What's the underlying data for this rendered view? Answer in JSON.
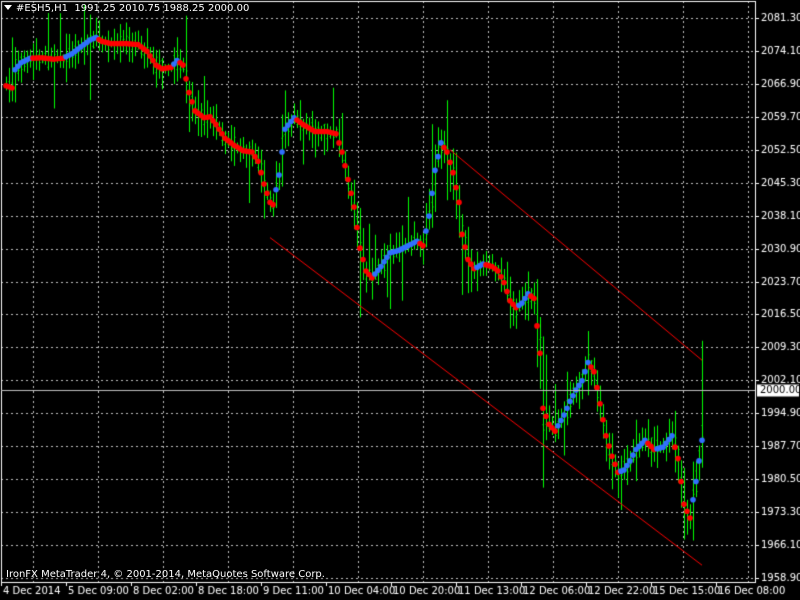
{
  "header": {
    "symbol_timeframe": "#ESH5,H1",
    "ohlc": "1991.25 2010.75 1988.25 2000.00"
  },
  "footer": {
    "copyright": "IronFX MetaTrader 4, © 2001-2014, MetaQuotes Software Corp."
  },
  "colors": {
    "background": "#000000",
    "grid": "#c0c0c0",
    "bars": "#00ff00",
    "dots_up": "#3070ff",
    "dots_down": "#ff0000",
    "channel": "#ff0000",
    "axis_text": "#ffffff",
    "price_label_bg": "#ffffff",
    "price_label_text": "#000000"
  },
  "chart_data": {
    "type": "line",
    "chart_kind": "ohlc-bars-with-moving-average-dots",
    "ylim": [
      1958.9,
      2082.6
    ],
    "y_ticks": [
      "2081.30",
      "2074.10",
      "2066.90",
      "2059.70",
      "2052.50",
      "2045.30",
      "2038.10",
      "2030.90",
      "2023.70",
      "2016.50",
      "2009.30",
      "2002.10",
      "1994.90",
      "1987.70",
      "1980.50",
      "1973.30",
      "1966.10",
      "1958.90"
    ],
    "x_ticks": [
      "4 Dec 2014",
      "5 Dec 09:00",
      "8 Dec 02:00",
      "8 Dec 18:00",
      "9 Dec 11:00",
      "10 Dec 04:00",
      "10 Dec 20:00",
      "11 Dec 13:00",
      "12 Dec 06:00",
      "12 Dec 22:00",
      "15 Dec 15:00",
      "16 Dec 08:00"
    ],
    "current_price": "2000.00",
    "grid": true,
    "ma_path": [
      [
        0,
        2066.5
      ],
      [
        2,
        2066.0
      ],
      [
        3,
        2070.0
      ],
      [
        5,
        2071.5
      ],
      [
        8,
        2072.5
      ],
      [
        12,
        2072.6
      ],
      [
        16,
        2072.3
      ],
      [
        19,
        2072.5
      ],
      [
        22,
        2073.5
      ],
      [
        25,
        2075.0
      ],
      [
        28,
        2076.5
      ],
      [
        30,
        2077.0
      ],
      [
        32,
        2076.2
      ],
      [
        35,
        2075.7
      ],
      [
        40,
        2075.7
      ],
      [
        44,
        2075.5
      ],
      [
        47,
        2074.0
      ],
      [
        50,
        2071.0
      ],
      [
        52,
        2070.2
      ],
      [
        55,
        2070.5
      ],
      [
        57,
        2072.0
      ],
      [
        59,
        2071.0
      ],
      [
        61,
        2065.0
      ],
      [
        63,
        2061.0
      ],
      [
        66,
        2059.5
      ],
      [
        68,
        2059.7
      ],
      [
        70,
        2058.0
      ],
      [
        73,
        2055.0
      ],
      [
        76,
        2053.5
      ],
      [
        79,
        2052.3
      ],
      [
        82,
        2052.0
      ],
      [
        84,
        2050.0
      ],
      [
        86,
        2045.0
      ],
      [
        88,
        2041.0
      ],
      [
        89,
        2040.5
      ],
      [
        91,
        2047.0
      ],
      [
        93,
        2057.0
      ],
      [
        96,
        2059.5
      ],
      [
        99,
        2058.0
      ],
      [
        103,
        2056.5
      ],
      [
        107,
        2056.5
      ],
      [
        110,
        2056.0
      ],
      [
        112,
        2052.0
      ],
      [
        114,
        2046.0
      ],
      [
        116,
        2040.0
      ],
      [
        118,
        2031.0
      ],
      [
        120,
        2026.0
      ],
      [
        122,
        2024.5
      ],
      [
        125,
        2027.0
      ],
      [
        128,
        2030.0
      ],
      [
        131,
        2030.5
      ],
      [
        134,
        2031.5
      ],
      [
        137,
        2032.5
      ],
      [
        139,
        2031.5
      ],
      [
        141,
        2038.0
      ],
      [
        143,
        2048.0
      ],
      [
        145,
        2054.0
      ],
      [
        147,
        2052.0
      ],
      [
        149,
        2047.5
      ],
      [
        151,
        2041.0
      ],
      [
        152,
        2034.0
      ],
      [
        154,
        2028.5
      ],
      [
        156,
        2026.5
      ],
      [
        159,
        2027.5
      ],
      [
        162,
        2027.0
      ],
      [
        164,
        2026.0
      ],
      [
        166,
        2023.5
      ],
      [
        168,
        2019.5
      ],
      [
        170,
        2018.0
      ],
      [
        172,
        2019.0
      ],
      [
        174,
        2021.0
      ],
      [
        176,
        2020.0
      ],
      [
        178,
        2008.0
      ],
      [
        179,
        1996.0
      ],
      [
        181,
        1992.5
      ],
      [
        183,
        1991.0
      ],
      [
        186,
        1994.5
      ],
      [
        188,
        1997.5
      ],
      [
        190,
        2000.0
      ],
      [
        192,
        2002.0
      ],
      [
        194,
        2006.0
      ],
      [
        196,
        2004.0
      ],
      [
        198,
        1997.0
      ],
      [
        200,
        1990.0
      ],
      [
        202,
        1985.5
      ],
      [
        204,
        1982.0
      ],
      [
        206,
        1982.5
      ],
      [
        208,
        1984.5
      ],
      [
        210,
        1987.0
      ],
      [
        213,
        1989.0
      ],
      [
        216,
        1987.0
      ],
      [
        219,
        1987.5
      ],
      [
        222,
        1990.0
      ],
      [
        224,
        1985.0
      ],
      [
        226,
        1975.0
      ],
      [
        228,
        1972.0
      ],
      [
        230,
        1980.0
      ],
      [
        232,
        1989.0
      ]
    ],
    "channel_lines": [
      {
        "name": "upper",
        "p1": [
          148,
          2052.5
        ],
        "p2": [
          232,
          2006.5
        ]
      },
      {
        "name": "lower",
        "p1": [
          88,
          2033.3
        ],
        "p2": [
          232,
          1961.7
        ]
      }
    ]
  }
}
